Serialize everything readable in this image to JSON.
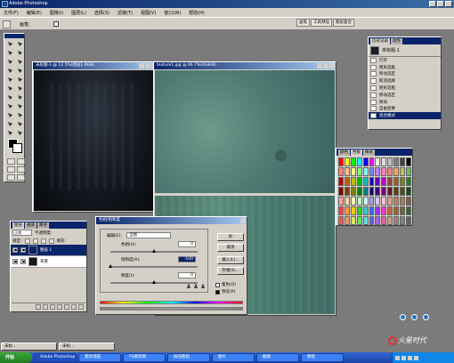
{
  "app": {
    "title": "Adobe Photoshop"
  },
  "menu": [
    "文件(F)",
    "编辑(E)",
    "图像(I)",
    "图层(L)",
    "选择(S)",
    "滤镜(T)",
    "视图(V)",
    "窗口(W)",
    "帮助(H)"
  ],
  "options": {
    "label": "画笔:",
    "palette_tabs": [
      "画笔",
      "工具预设",
      "图层复合"
    ]
  },
  "documents": {
    "dark": {
      "title": "未标题-1 @ 12.5%(图层1,RGB)"
    },
    "texture": {
      "title": "texture1.jpg @ 66.7%(RGB/8)"
    }
  },
  "history": {
    "tabs": [
      "历史记录",
      "动作"
    ],
    "snapshot": "未标题-1",
    "items": [
      "打开",
      "矩形选框",
      "移动选区",
      "取消选择",
      "矩形选框",
      "移动选区",
      "移动",
      "自由变换",
      "混合模式"
    ],
    "selected_index": 8
  },
  "swatches": {
    "tabs": [
      "颜色",
      "色板",
      "样式"
    ],
    "colors": [
      "#ff0000",
      "#ffff00",
      "#00ff00",
      "#00ffff",
      "#0000ff",
      "#ff00ff",
      "#ffffff",
      "#e0e0e0",
      "#c0c0c0",
      "#808080",
      "#404040",
      "#000000",
      "#ff8080",
      "#ffc080",
      "#ffff80",
      "#80ff80",
      "#80ffff",
      "#8080ff",
      "#c080ff",
      "#ff80c0",
      "#f08080",
      "#ffa060",
      "#c0c060",
      "#60c060",
      "#c00000",
      "#c06000",
      "#c0c000",
      "#00c000",
      "#00c0c0",
      "#0000c0",
      "#6000c0",
      "#c000c0",
      "#a04040",
      "#a06020",
      "#808020",
      "#208020",
      "#800000",
      "#804000",
      "#808000",
      "#008000",
      "#008080",
      "#000080",
      "#400080",
      "#800080",
      "#602020",
      "#604010",
      "#505010",
      "#105010",
      "#ffa0a0",
      "#ffd0a0",
      "#ffffc0",
      "#c0ffc0",
      "#c0ffff",
      "#a0a0ff",
      "#e0c0ff",
      "#ffc0e0",
      "#e0a080",
      "#c08060",
      "#a08060",
      "#806040",
      "#ff4040",
      "#ff9933",
      "#ffcc00",
      "#33cc33",
      "#33cccc",
      "#3366ff",
      "#9933ff",
      "#ff33cc",
      "#cc6633",
      "#996633",
      "#666633",
      "#336633",
      "#e06060",
      "#e0a060",
      "#e0e060",
      "#60e060",
      "#60e0e0",
      "#6060e0",
      "#a060e0",
      "#e060a0",
      "#c0a080",
      "#a08080",
      "#808080",
      "#606060"
    ]
  },
  "layers": {
    "tabs": [
      "图层",
      "通道",
      "路径"
    ],
    "blend_mode": "正常",
    "opacity_label": "不透明度:",
    "lock_label": "锁定:",
    "fill_label": "填充:",
    "rows": [
      {
        "name": "图层 1",
        "selected": true,
        "thumb_color": "#0a246a"
      },
      {
        "name": "背景",
        "selected": false,
        "thumb_color": "#15181d"
      }
    ]
  },
  "hue_sat": {
    "title": "色相/饱和度",
    "edit_label": "编辑(E):",
    "edit_value": "全图",
    "hue_label": "色相(H):",
    "hue_value": "0",
    "sat_label": "饱和度(A):",
    "sat_value": "-100",
    "light_label": "明度(I):",
    "light_value": "0",
    "buttons": {
      "ok": "好",
      "cancel": "取消",
      "load": "载入(L)...",
      "save": "存储(S)..."
    },
    "colorize": {
      "label": "着色(O)",
      "checked": false
    },
    "preview": {
      "label": "预览(P)",
      "checked": true
    },
    "sat_level": 0.0,
    "hue_level": 0.5,
    "light_level": 0.5
  },
  "minimized": [
    {
      "label": "未标..."
    },
    {
      "label": "未标..."
    }
  ],
  "taskbar": {
    "start": "开始",
    "tasks": [
      {
        "label": "Adobe Photoshop",
        "active": true
      },
      {
        "label": "我的电脑"
      },
      {
        "label": "PS教程网"
      },
      {
        "label": "按钮教程"
      },
      {
        "label": "图片"
      },
      {
        "label": "截图"
      },
      {
        "label": "教程"
      }
    ]
  },
  "watermark": "火星时代"
}
